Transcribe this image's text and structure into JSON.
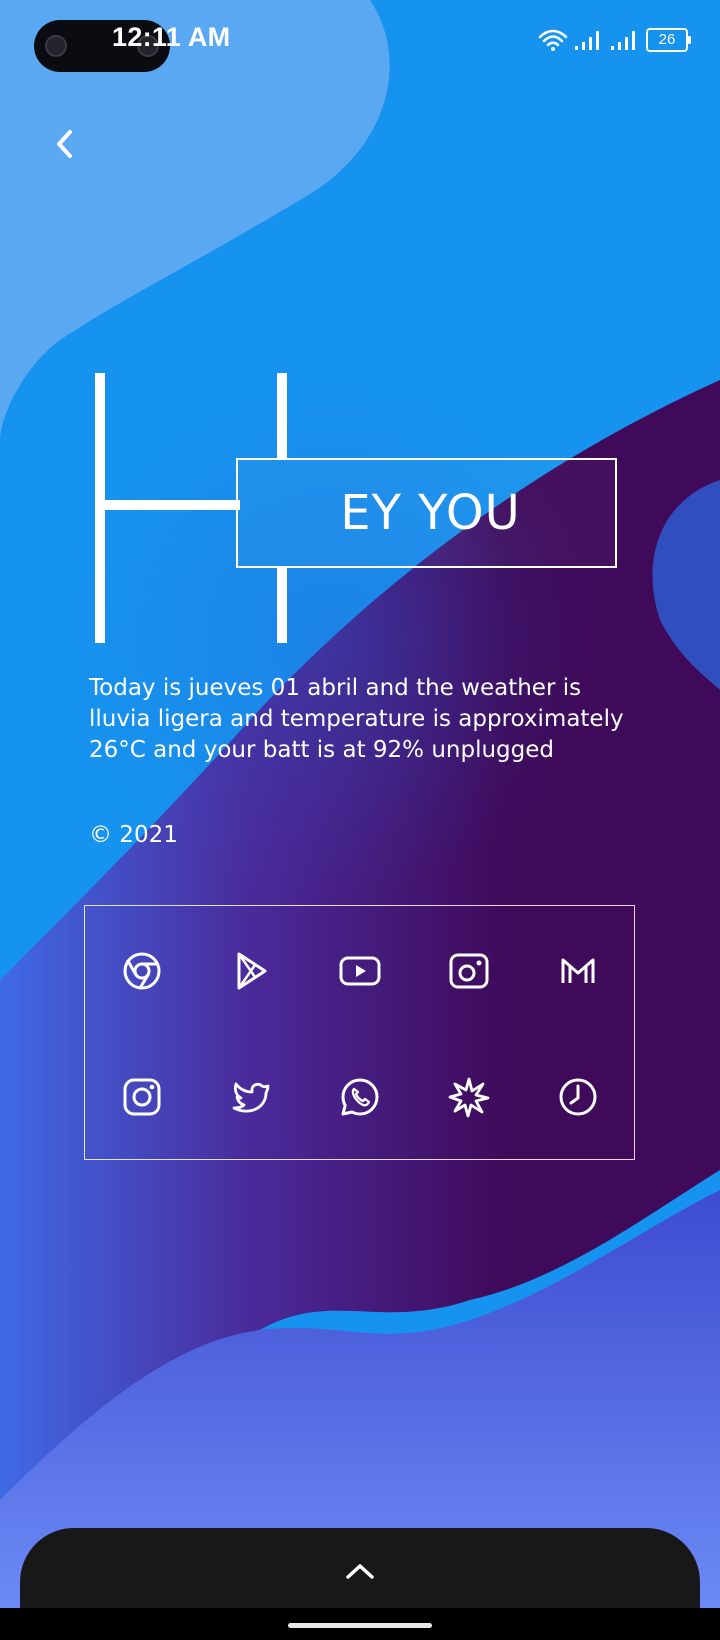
{
  "status_bar": {
    "time": "12:11 AM",
    "battery_level": "26",
    "icons": [
      "wifi-icon",
      "signal-icon",
      "signal-icon",
      "battery-icon"
    ]
  },
  "header": {
    "back_icon": "chevron-left-icon"
  },
  "widget": {
    "big_letter": "H",
    "title": "EY YOU",
    "info": "Today is  jueves 01 abril and the weather is lluvia ligera and temperature is approximately 26°C and your batt is at 92% unplugged",
    "copyright": "© 2021"
  },
  "apps": [
    {
      "name": "chrome",
      "icon": "chrome-icon"
    },
    {
      "name": "play-store",
      "icon": "play-store-icon"
    },
    {
      "name": "youtube",
      "icon": "youtube-icon"
    },
    {
      "name": "camera",
      "icon": "camera-icon"
    },
    {
      "name": "gmail",
      "icon": "gmail-icon"
    },
    {
      "name": "instagram",
      "icon": "instagram-icon"
    },
    {
      "name": "twitter",
      "icon": "twitter-icon"
    },
    {
      "name": "whatsapp",
      "icon": "whatsapp-icon"
    },
    {
      "name": "photos",
      "icon": "photos-icon"
    },
    {
      "name": "clock",
      "icon": "clock-icon"
    }
  ],
  "dock": {
    "expand_icon": "chevron-up-icon"
  },
  "colors": {
    "wallpaper_light_blue": "#5aa8f2",
    "wallpaper_blue": "#1693ee",
    "wallpaper_purple": "#3f0a5a",
    "wallpaper_periwinkle": "#6c8cf6",
    "dock": "#181818"
  }
}
